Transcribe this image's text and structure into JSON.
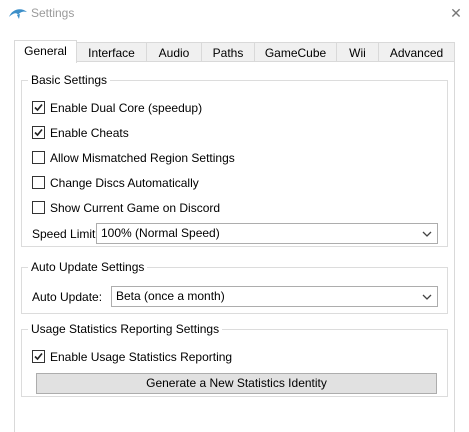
{
  "window": {
    "title": "Settings",
    "close_glyph": "✕",
    "app_icon": "dolphin-icon"
  },
  "tabs": [
    {
      "label": "General",
      "selected": true
    },
    {
      "label": "Interface",
      "selected": false
    },
    {
      "label": "Audio",
      "selected": false
    },
    {
      "label": "Paths",
      "selected": false
    },
    {
      "label": "GameCube",
      "selected": false
    },
    {
      "label": "Wii",
      "selected": false
    },
    {
      "label": "Advanced",
      "selected": false
    }
  ],
  "basic": {
    "title": "Basic Settings",
    "options": [
      {
        "label": "Enable Dual Core (speedup)",
        "checked": true
      },
      {
        "label": "Enable Cheats",
        "checked": true
      },
      {
        "label": "Allow Mismatched Region Settings",
        "checked": false
      },
      {
        "label": "Change Discs Automatically",
        "checked": false
      },
      {
        "label": "Show Current Game on Discord",
        "checked": false
      }
    ],
    "speed_limit_label": "Speed Limit:",
    "speed_limit_value": "100% (Normal Speed)"
  },
  "auto_update": {
    "title": "Auto Update Settings",
    "label": "Auto Update:",
    "value": "Beta (once a month)"
  },
  "usage": {
    "title": "Usage Statistics Reporting Settings",
    "enable_label": "Enable Usage Statistics Reporting",
    "enable_checked": true,
    "generate_button": "Generate a New Statistics Identity"
  },
  "colors": {
    "accent": "#3c8fc9",
    "tab_bg": "#f0f0f0",
    "border": "#d9d9d9"
  }
}
